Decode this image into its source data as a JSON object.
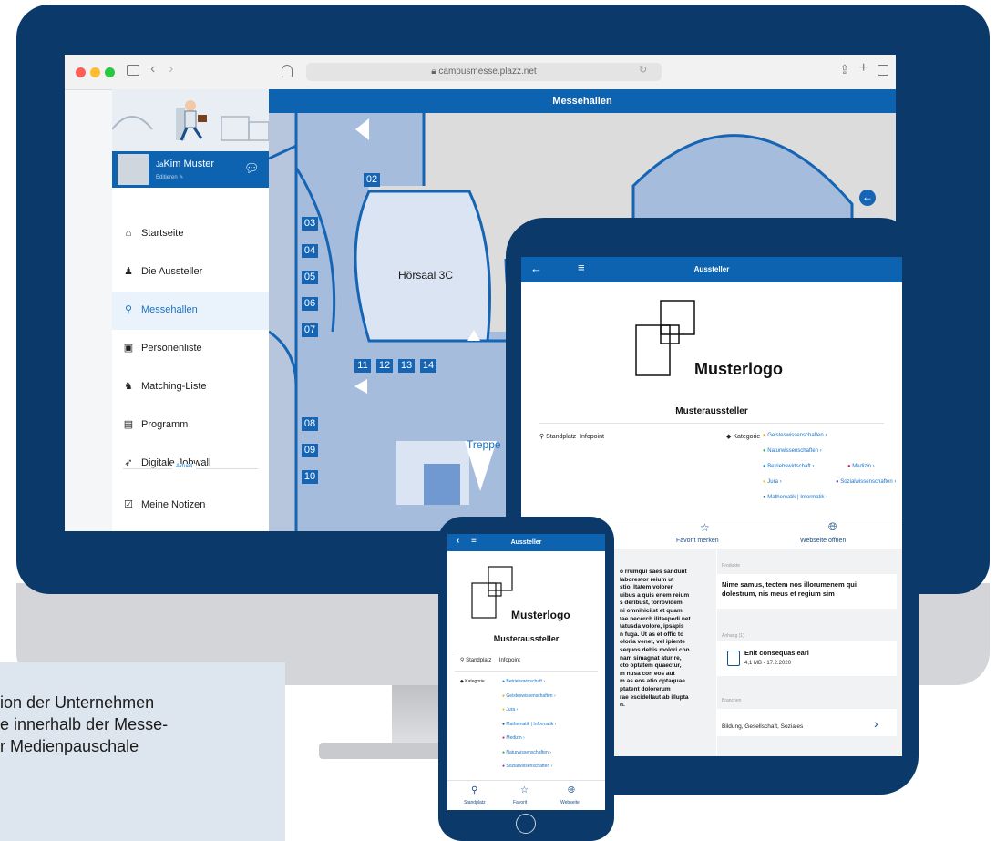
{
  "desktop": {
    "url": "campusmesse.plazz.net",
    "page_title": "Messehallen",
    "user": {
      "name": "Kim Muster",
      "initials": "Ja",
      "edit_label": "Editieren"
    },
    "nav": [
      {
        "label": "Startseite",
        "icon": "home-icon"
      },
      {
        "label": "Die Aussteller",
        "icon": "person-icon"
      },
      {
        "label": "Messehallen",
        "icon": "map-pin-icon",
        "active": true
      },
      {
        "label": "Personenliste",
        "icon": "contact-card-icon"
      },
      {
        "label": "Matching-Liste",
        "icon": "people-icon"
      },
      {
        "label": "Programm",
        "icon": "calendar-icon"
      },
      {
        "label": "Digitale Jobwall",
        "icon": "pin-icon"
      },
      {
        "label": "Meine Notizen",
        "icon": "notes-icon"
      }
    ],
    "nav_section_label": "Aktuell",
    "map": {
      "hall_name": "Hörsaal 3C",
      "stairs_label": "Treppe",
      "rooms_left": [
        "03",
        "04",
        "05",
        "06",
        "07"
      ],
      "rooms_bottom": [
        "11",
        "12",
        "13",
        "14"
      ],
      "rooms_lower": [
        "08",
        "09",
        "10"
      ],
      "room_top": "02"
    }
  },
  "tablet": {
    "title": "Aussteller",
    "logo_text": "Musterlogo",
    "exhibitor_name": "Musteraussteller",
    "standplatz_label": "Standplatz",
    "standplatz_value": "Infopoint",
    "kategorie_label": "Kategorie",
    "categories": [
      {
        "name": "Geisteswissenschaften",
        "color": "#f2a12e"
      },
      {
        "name": "Naturwissenschaften",
        "color": "#2fa84f"
      },
      {
        "name": "Betriebswirtschaft",
        "color": "#1e88d6"
      },
      {
        "name": "Medizin",
        "color": "#e0245e"
      },
      {
        "name": "Jura",
        "color": "#e6c21c"
      },
      {
        "name": "Sozialwissenschaften",
        "color": "#7b3fc4"
      },
      {
        "name": "Mathematik | Informatik",
        "color": "#1a4f8a"
      }
    ],
    "actions": {
      "favorit": "Favorit merken",
      "webseite": "Webseite öffnen"
    },
    "produkte_label": "Produkte",
    "produkte_text": "Nime samus, tectem nos illorumenem qui dolestrum, nis meus et regium sim",
    "anhang_label": "Anhang (1)",
    "anhang_title": "Enit consequas eari",
    "anhang_meta": "4,1 MB - 17.2.2020",
    "branchen_label": "Branchen",
    "branchen_value": "Bildung, Gesellschaft, Soziales",
    "body_text_lines": [
      "o rrumqui saes sandunt",
      "laborestor reium ut",
      "stio. Itatem volorer",
      "uibus a quis enem reium",
      "s deribust, torrovidem",
      "ni omnihiciist et quam",
      "tae necerch ilitaepedi net",
      "tatusda volore, ipsapis",
      "n fuga. Ut as et offic to",
      "oloria venet, vel ipiente",
      "sequos debis molori con",
      "nam simagnat atur re,",
      "cto optatem quaectur,",
      "m nusa con eos aut",
      "m as eos atio optaquae",
      "ptatent dolorerum",
      "rae escidellaut ab illupta",
      "n."
    ]
  },
  "phone": {
    "title": "Aussteller",
    "logo_text": "Musterlogo",
    "exhibitor_name": "Musteraussteller",
    "standplatz_label": "Standplatz",
    "standplatz_value": "Infopoint",
    "kategorie_label": "Kategorie",
    "categories": [
      {
        "name": "Betriebswirtschaft",
        "color": "#1e88d6"
      },
      {
        "name": "Geisteswissenschaften",
        "color": "#f2a12e"
      },
      {
        "name": "Jura",
        "color": "#e6c21c"
      },
      {
        "name": "Mathematik | Informatik",
        "color": "#1a4f8a"
      },
      {
        "name": "Medizin",
        "color": "#e0245e"
      },
      {
        "name": "Naturwissenschaften",
        "color": "#2fa84f"
      },
      {
        "name": "Sozialwissenschaften",
        "color": "#7b3fc4"
      }
    ],
    "tabs": [
      "Standplatz",
      "Favorit",
      "Webseite"
    ]
  },
  "caption_lines": [
    "ion der Unternehmen",
    "e innerhalb der Messe-",
    "r Medienpauschale"
  ]
}
